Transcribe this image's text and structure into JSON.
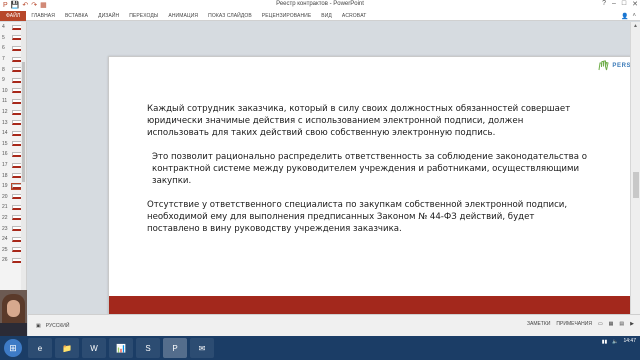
{
  "window": {
    "title": "Реестр контрактов - PowerPoint",
    "controls": [
      "?",
      "–",
      "□",
      "✕"
    ]
  },
  "qat": [
    "P",
    "💾",
    "↶",
    "↷",
    "▦"
  ],
  "ribbon": {
    "tabs": [
      "ФАЙЛ",
      "ГЛАВНАЯ",
      "ВСТАВКА",
      "ДИЗАЙН",
      "ПЕРЕХОДЫ",
      "АНИМАЦИЯ",
      "ПОКАЗ СЛАЙДОВ",
      "РЕЦЕНЗИРОВАНИЕ",
      "ВИД",
      "ACROBAT"
    ]
  },
  "thumbnails": [
    "4",
    "5",
    "6",
    "7",
    "8",
    "9",
    "10",
    "11",
    "12",
    "13",
    "14",
    "15",
    "16",
    "17",
    "18",
    "19",
    "20",
    "21",
    "22",
    "23",
    "24",
    "25",
    "26"
  ],
  "selected_thumbnail": "19",
  "slide": {
    "logo_text": "PERSIS",
    "logo_sub": "",
    "paragraphs": [
      "Каждый сотрудник заказчика, который в силу своих должностных обязанностей совершает юридически значимые действия с использованием электронной подписи, должен использовать для таких действий свою собственную электронную подпись.",
      "Это позволит рационально распределить ответственность за соблюдение законодательства о контрактной системе между руководителем учреждения и работниками, осуществляющими закупки.",
      "Отсутствие у ответственного специалиста по закупкам собственной электронной подписи, необходимой ему для выполнения предписанных Законом № 44-ФЗ действий, будет поставлено в вину руководству учреждения заказчика."
    ],
    "footer_color": "#a3281c"
  },
  "statusbar": {
    "language": "РУССКИЙ",
    "notes": "ЗАМЕТКИ",
    "comments": "ПРИМЕЧАНИЯ"
  },
  "taskbar": {
    "apps": [
      "e",
      "📁",
      "W",
      "📊",
      "S",
      "P",
      "✉"
    ],
    "time": "14:47"
  },
  "colors": {
    "accent": "#b7472a",
    "footer": "#a3281c",
    "taskbar": "#1b3d66"
  }
}
